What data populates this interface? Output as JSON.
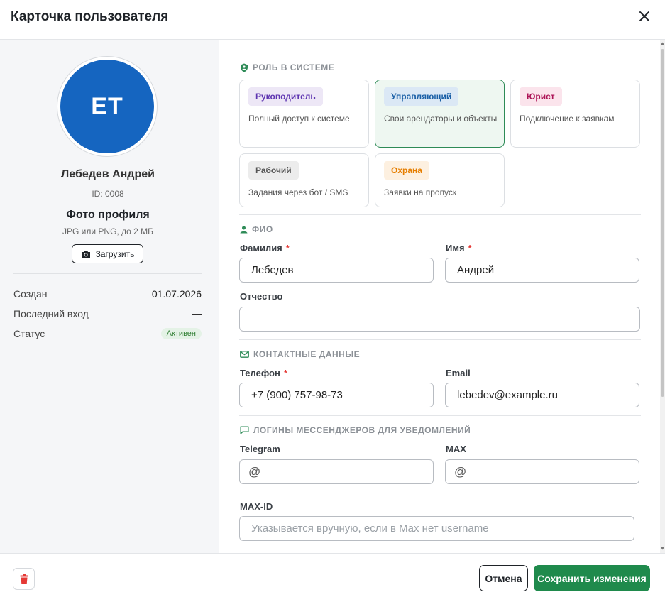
{
  "dialog": {
    "title": "Карточка пользователя"
  },
  "profile": {
    "initials": "ЕТ",
    "name": "Лебедев Андрей",
    "id_label": "ID: 0008",
    "photo_title": "Фото профиля",
    "photo_hint": "JPG или PNG, до 2 МБ",
    "upload_label": "Загрузить",
    "avatar_color": "#1565c0"
  },
  "meta": {
    "created_label": "Создан",
    "created_value": "01.07.2026",
    "last_login_label": "Последний вход",
    "last_login_value": "—",
    "status_label": "Статус",
    "status_value": "Активен"
  },
  "roles": {
    "section_title": "РОЛЬ В СИСТЕМЕ",
    "selected": "Управляющий",
    "items": [
      {
        "name": "Руководитель",
        "desc": "Полный доступ к системе",
        "badge_bg": "#ede7f6",
        "badge_fg": "#5e35b1"
      },
      {
        "name": "Управляющий",
        "desc": "Свои арендаторы и объекты",
        "badge_bg": "#dbe8f5",
        "badge_fg": "#1a5fa6"
      },
      {
        "name": "Юрист",
        "desc": "Подключение к заявкам",
        "badge_bg": "#fbe4ec",
        "badge_fg": "#ad1457"
      },
      {
        "name": "Рабочий",
        "desc": "Задания через бот / SMS",
        "badge_bg": "#ececec",
        "badge_fg": "#555555"
      },
      {
        "name": "Охрана",
        "desc": "Заявки на пропуск",
        "badge_bg": "#fdf0e0",
        "badge_fg": "#e67e00"
      }
    ]
  },
  "fio": {
    "section_title": "ФИО",
    "last_name_label": "Фамилия",
    "last_name_value": "Лебедев",
    "first_name_label": "Имя",
    "first_name_value": "Андрей",
    "patronymic_label": "Отчество",
    "patronymic_value": ""
  },
  "contacts": {
    "section_title": "КОНТАКТНЫЕ ДАННЫЕ",
    "phone_label": "Телефон",
    "phone_value": "+7 (900) 757-98-73",
    "email_label": "Email",
    "email_value": "lebedev@example.ru"
  },
  "messengers": {
    "section_title": "ЛОГИНЫ МЕССЕНДЖЕРОВ ДЛЯ УВЕДОМЛЕНИЙ",
    "telegram_label": "Telegram",
    "telegram_value": "",
    "max_label": "MAX",
    "max_value": "",
    "at_symbol": "@",
    "maxid_label": "MAX-ID",
    "maxid_placeholder": "Указывается вручную, если в Max нет username"
  },
  "footer": {
    "cancel_label": "Отмена",
    "save_label": "Сохранить изменения",
    "accent_color": "#1f8a4c",
    "danger_color": "#e53935"
  },
  "required_mark": "*"
}
